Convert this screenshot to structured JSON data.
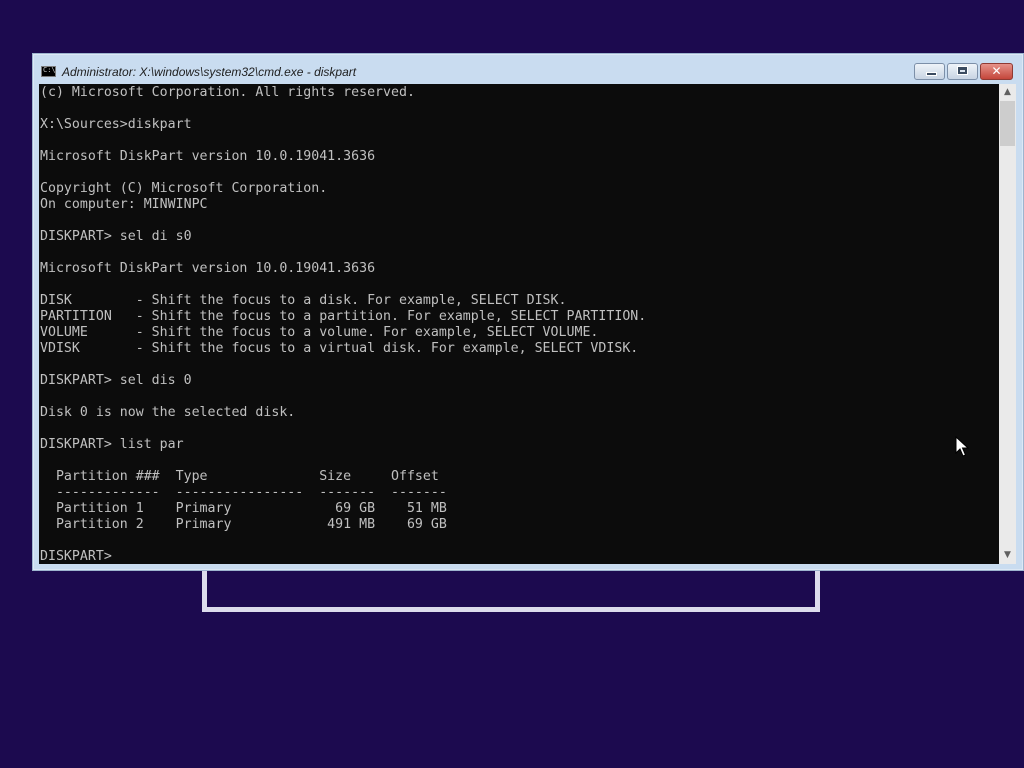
{
  "window": {
    "title": "Administrator: X:\\windows\\system32\\cmd.exe - diskpart",
    "icon": "cmd-icon",
    "icon_text": "C:\\",
    "buttons": {
      "minimize": "minimize-icon",
      "maximize": "maximize-icon",
      "close": "close-icon",
      "close_glyph": "✕"
    }
  },
  "console": {
    "lines": [
      "(c) Microsoft Corporation. All rights reserved.",
      "",
      "X:\\Sources>diskpart",
      "",
      "Microsoft DiskPart version 10.0.19041.3636",
      "",
      "Copyright (C) Microsoft Corporation.",
      "On computer: MINWINPC",
      "",
      "DISKPART> sel di s0",
      "",
      "Microsoft DiskPart version 10.0.19041.3636",
      "",
      "DISK        - Shift the focus to a disk. For example, SELECT DISK.",
      "PARTITION   - Shift the focus to a partition. For example, SELECT PARTITION.",
      "VOLUME      - Shift the focus to a volume. For example, SELECT VOLUME.",
      "VDISK       - Shift the focus to a virtual disk. For example, SELECT VDISK.",
      "",
      "DISKPART> sel dis 0",
      "",
      "Disk 0 is now the selected disk.",
      "",
      "DISKPART> list par",
      "",
      "  Partition ###  Type              Size     Offset",
      "  -------------  ----------------  -------  -------",
      "  Partition 1    Primary             69 GB    51 MB",
      "  Partition 2    Primary            491 MB    69 GB",
      "",
      "DISKPART> "
    ],
    "colors": {
      "background": "#0c0c0c",
      "foreground": "#c0c0c0"
    }
  },
  "scrollbar": {
    "up_glyph": "▲",
    "down_glyph": "▼"
  },
  "background_color": "#1c0a4f"
}
